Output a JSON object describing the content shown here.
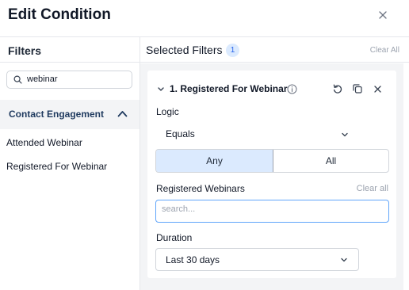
{
  "header": {
    "title": "Edit Condition",
    "close_icon": "close-icon"
  },
  "filters_panel": {
    "title": "Filters",
    "search": {
      "value": "webinar",
      "placeholder": ""
    },
    "category": {
      "label": "Contact Engagement",
      "expanded": true
    },
    "options": [
      {
        "label": "Attended Webinar"
      },
      {
        "label": "Registered For Webinar"
      }
    ]
  },
  "selected_panel": {
    "title": "Selected Filters",
    "count": "1",
    "clear_all_label": "Clear All",
    "condition": {
      "title": "1. Registered For Webinar",
      "logic": {
        "label": "Logic",
        "value": "Equals"
      },
      "match_mode": {
        "options": [
          "Any",
          "All"
        ],
        "selected": "Any"
      },
      "registered_webinars": {
        "label": "Registered Webinars",
        "clear_label": "Clear all",
        "search_placeholder": "search..."
      },
      "duration": {
        "label": "Duration",
        "value": "Last 30 days"
      }
    }
  },
  "colors": {
    "accent": "#60a5fa",
    "selected_segment": "#dbeafe",
    "badge_text": "#2563eb",
    "category_label": "#1f3a5f",
    "muted_text": "#9ca3af"
  }
}
